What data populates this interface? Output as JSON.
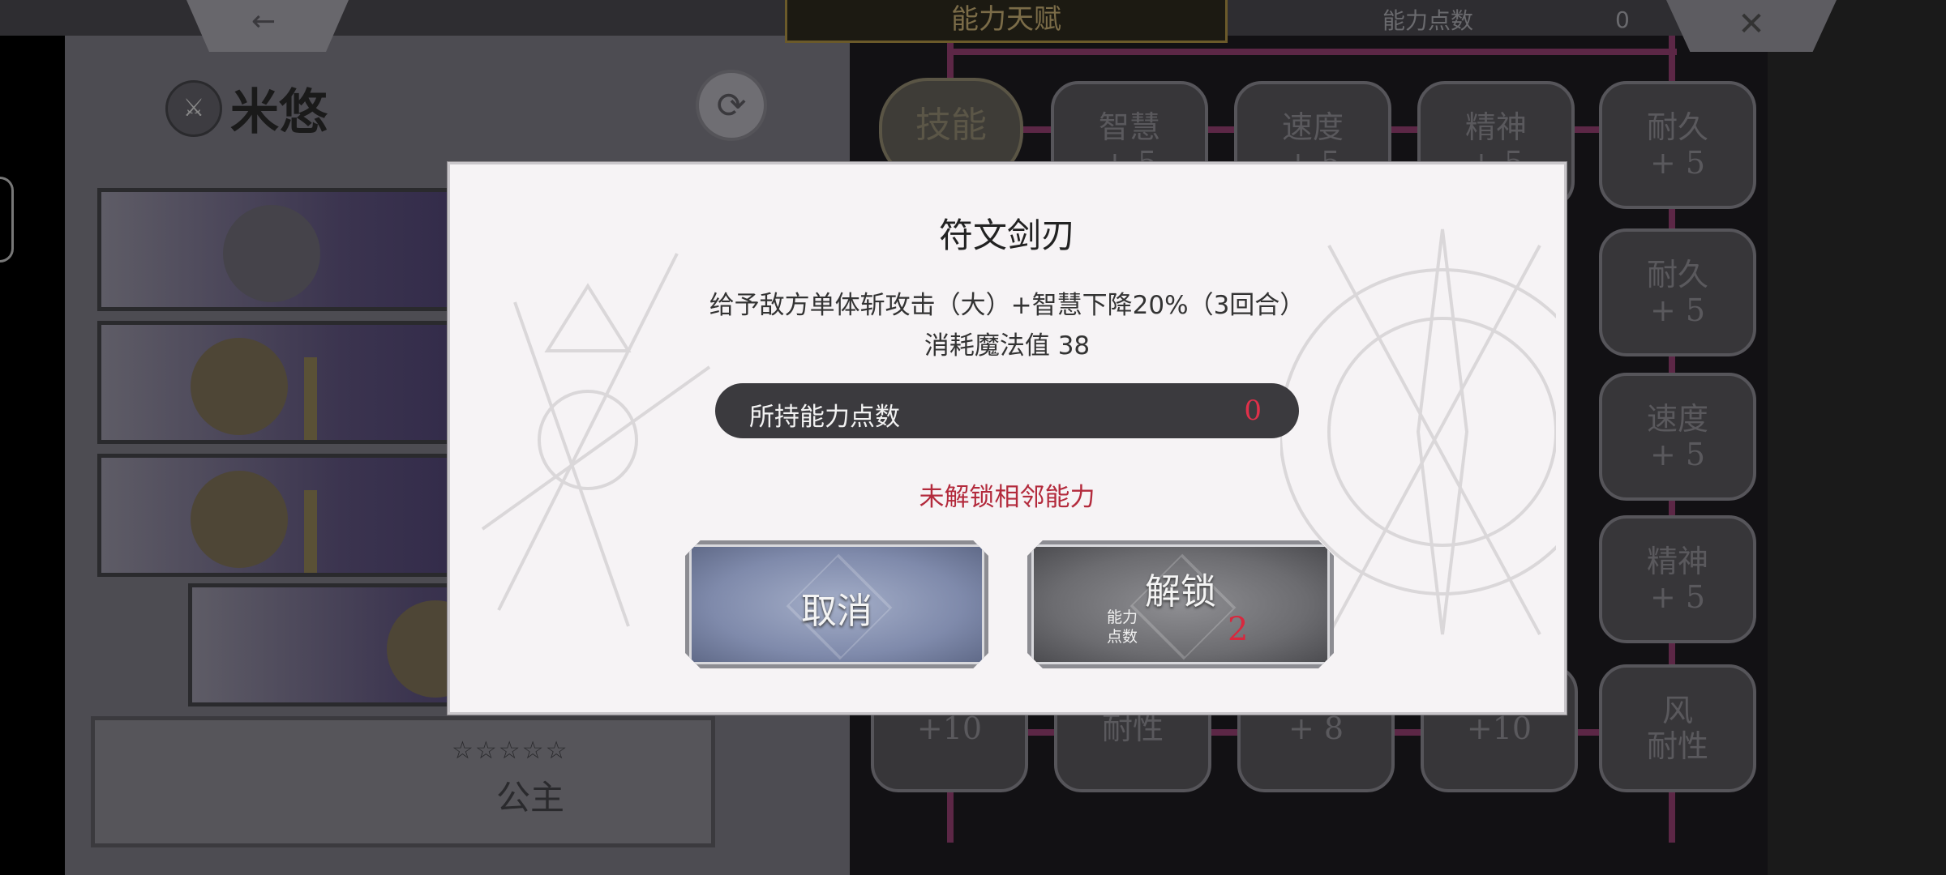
{
  "header": {
    "back_icon": "←",
    "title": "能力天赋",
    "points_label": "能力点数",
    "points_value": "0",
    "close_icon": "✕"
  },
  "character": {
    "name": "米悠",
    "refresh_icon": "⟳",
    "rank_stars": "☆☆☆☆☆",
    "rank_title": "公主"
  },
  "skill_grid": {
    "skill_label": "技能",
    "row1": [
      {
        "name": "智慧",
        "bonus": "+ 5"
      },
      {
        "name": "速度",
        "bonus": "+ 5"
      },
      {
        "name": "精神",
        "bonus": "+ 5"
      },
      {
        "name": "耐久",
        "bonus": "+ 5"
      }
    ],
    "right_col": [
      {
        "name": "耐久",
        "bonus": "+ 5"
      },
      {
        "name": "速度",
        "bonus": "+ 5"
      },
      {
        "name": "精神",
        "bonus": "+ 5"
      }
    ],
    "bottom_row": [
      {
        "name": "",
        "bonus": "+10"
      },
      {
        "name": "耐性",
        "bonus": ""
      },
      {
        "name": "",
        "bonus": "+ 8"
      },
      {
        "name": "",
        "bonus": "+10"
      },
      {
        "name": "风",
        "bonus": "耐性"
      }
    ]
  },
  "modal": {
    "title": "符文剑刃",
    "description": "给予敌方单体斩攻击（大）+智慧下降20%（3回合）",
    "cost": "消耗魔法值 38",
    "points_label": "所持能力点数",
    "points_value": "0",
    "warning": "未解锁相邻能力",
    "cancel_label": "取消",
    "unlock_label": "解锁",
    "unlock_cost_label": "能力\n点数",
    "unlock_cost_value": "2"
  },
  "colors": {
    "modal_bg": "#f6f3f5",
    "warning": "#b32a3c",
    "points_value": "#e0304a",
    "cancel_button": "#7f8aab",
    "unlock_button": "#6c6c70"
  }
}
